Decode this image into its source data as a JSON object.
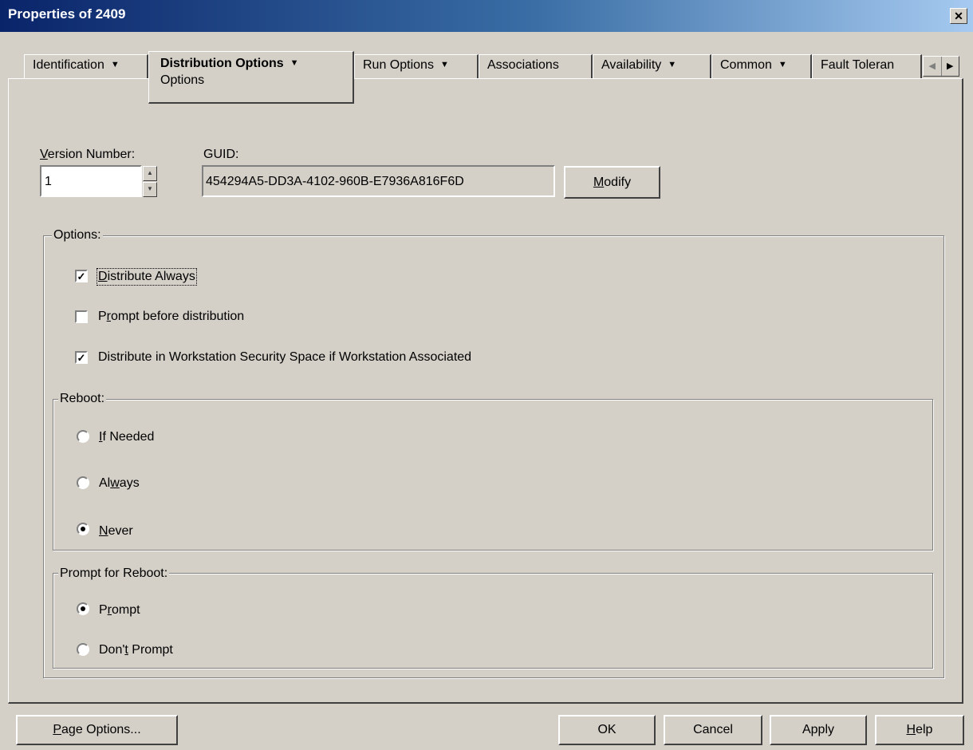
{
  "window": {
    "title": "Properties of 2409",
    "close_label": "✕"
  },
  "tabs": [
    {
      "label": "Identification",
      "has_menu": true
    },
    {
      "label": "Distribution Options",
      "has_menu": true,
      "selected": true,
      "sub_label": "Options"
    },
    {
      "label": "Run Options",
      "has_menu": true
    },
    {
      "label": "Associations",
      "has_menu": false
    },
    {
      "label": "Availability",
      "has_menu": true
    },
    {
      "label": "Common",
      "has_menu": true
    },
    {
      "label": "Fault Toleran",
      "has_menu": false
    }
  ],
  "tab_scroll": {
    "left_icon": "◀",
    "right_icon": "▶"
  },
  "version": {
    "label": "Version Number:",
    "value": "1",
    "up_icon": "▲",
    "down_icon": "▼"
  },
  "guid": {
    "label": "GUID:",
    "value": "454294A5-DD3A-4102-960B-E7936A816F6D",
    "modify_label": "Modify"
  },
  "options": {
    "label": "Options:",
    "checkboxes": [
      {
        "label": "Distribute Always",
        "checked": true
      },
      {
        "label": "Prompt before distribution",
        "checked": false
      },
      {
        "label": "Distribute in Workstation Security Space if Workstation Associated",
        "checked": true
      }
    ]
  },
  "reboot": {
    "label": "Reboot:",
    "options": [
      {
        "label": "If Needed",
        "selected": false
      },
      {
        "label": "Always",
        "selected": false
      },
      {
        "label": "Never",
        "selected": true
      }
    ]
  },
  "prompt_reboot": {
    "label": "Prompt for Reboot:",
    "options": [
      {
        "label": "Prompt",
        "selected": true
      },
      {
        "label": "Don't Prompt",
        "selected": false
      }
    ]
  },
  "buttons": {
    "page_options": "Page Options...",
    "ok": "OK",
    "cancel": "Cancel",
    "apply": "Apply",
    "help": "Help"
  },
  "check_mark": "✓"
}
